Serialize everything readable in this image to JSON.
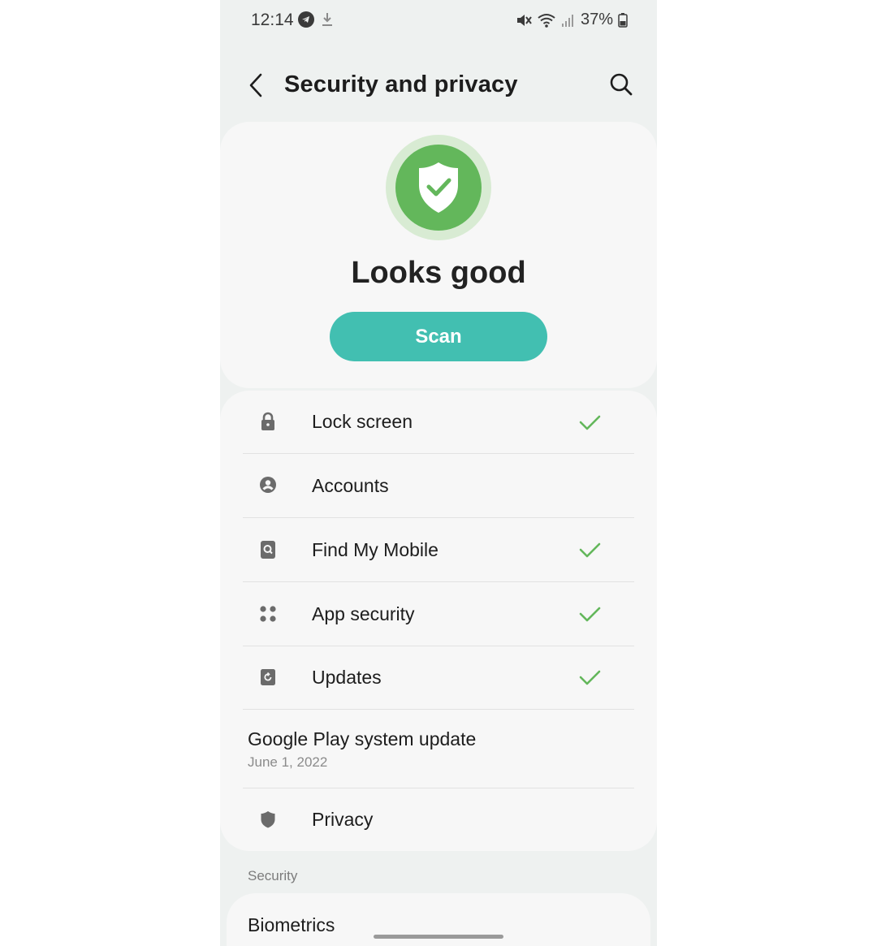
{
  "status_bar": {
    "time": "12:14",
    "battery": "37%"
  },
  "header": {
    "title": "Security and privacy"
  },
  "status": {
    "title": "Looks good",
    "scan_label": "Scan",
    "accent_color": "#42bfb1",
    "ok_color": "#63b75b"
  },
  "items": [
    {
      "label": "Lock screen",
      "icon": "lock-icon",
      "checked": true
    },
    {
      "label": "Accounts",
      "icon": "account-icon",
      "checked": false
    },
    {
      "label": "Find My Mobile",
      "icon": "find-my-mobile-icon",
      "checked": true
    },
    {
      "label": "App security",
      "icon": "app-security-icon",
      "checked": true
    },
    {
      "label": "Updates",
      "icon": "updates-icon",
      "checked": true
    }
  ],
  "google_play": {
    "title": "Google Play system update",
    "date": "June 1, 2022"
  },
  "privacy": {
    "label": "Privacy",
    "icon": "privacy-shield-icon"
  },
  "section": {
    "label": "Security"
  },
  "biometrics": {
    "label": "Biometrics"
  }
}
